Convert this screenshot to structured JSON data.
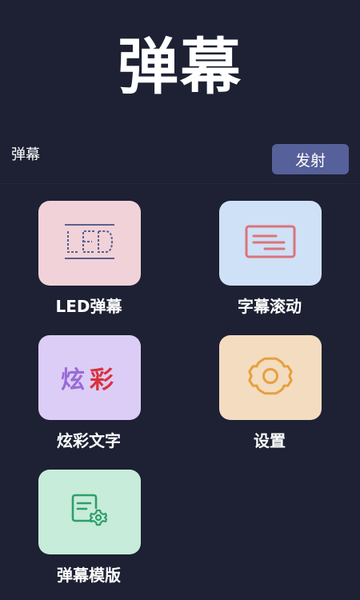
{
  "header": {
    "title": "弹幕"
  },
  "input": {
    "placeholder": "弹幕",
    "value": ""
  },
  "send_button": {
    "label": "发射"
  },
  "tiles": [
    {
      "label": "LED弹幕",
      "icon": "led-icon",
      "bg": "#f1d2d8"
    },
    {
      "label": "字幕滚动",
      "icon": "subtitle-card-icon",
      "bg": "#cfe1f6"
    },
    {
      "label": "炫彩文字",
      "icon": "colorful-text-icon",
      "bg": "#dccdf6",
      "icon_text": [
        "炫",
        "彩"
      ]
    },
    {
      "label": "设置",
      "icon": "gear-icon",
      "bg": "#f3dcc0"
    },
    {
      "label": "弹幕模版",
      "icon": "template-document-icon",
      "bg": "#c7ecd9"
    }
  ],
  "colors": {
    "background": "#1d2133",
    "button": "#56609a"
  }
}
